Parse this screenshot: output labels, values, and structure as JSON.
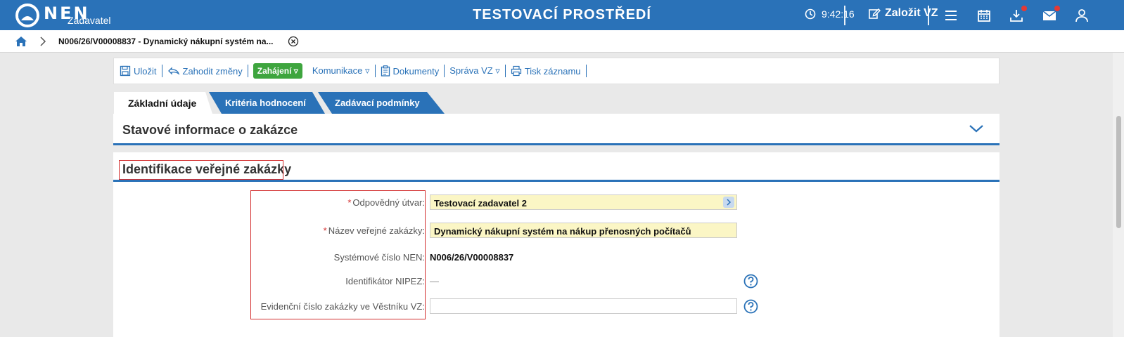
{
  "header": {
    "logo_text": "NEN",
    "logo_sub": "Zadavatel",
    "env_title": "TESTOVACÍ PROSTŘEDÍ",
    "clock": "9:42:16",
    "create_label": "Založit VZ"
  },
  "breadcrumb": {
    "current": "N006/26/V00008837 - Dynamický nákupní systém na..."
  },
  "toolbar": {
    "save": "Uložit",
    "discard": "Zahodit změny",
    "start": "Zahájení ▿",
    "communication": "Komunikace ▿",
    "documents": "Dokumenty",
    "management": "Správa VZ ▿",
    "print": "Tisk záznamu"
  },
  "tabs": {
    "basic": "Základní údaje",
    "criteria": "Kritéria hodnocení",
    "conditions": "Zadávací podmínky"
  },
  "sections": {
    "status": "Stavové informace o zakázce",
    "identification": "Identifikace veřejné zakázky"
  },
  "form": {
    "required_mark": "*",
    "unit_label": "Odpovědný útvar:",
    "unit_value": "Testovací zadavatel 2",
    "name_label": "Název veřejné zakázky:",
    "name_value": "Dynamický nákupní systém na nákup přenosných počítačů",
    "sysnum_label": "Systémové číslo NEN:",
    "sysnum_value": "N006/26/V00008837",
    "nipez_label": "Identifikátor NIPEZ:",
    "nipez_value": "—",
    "journal_label": "Evidenční číslo zakázky ve Věstníku VZ:",
    "journal_value": ""
  }
}
